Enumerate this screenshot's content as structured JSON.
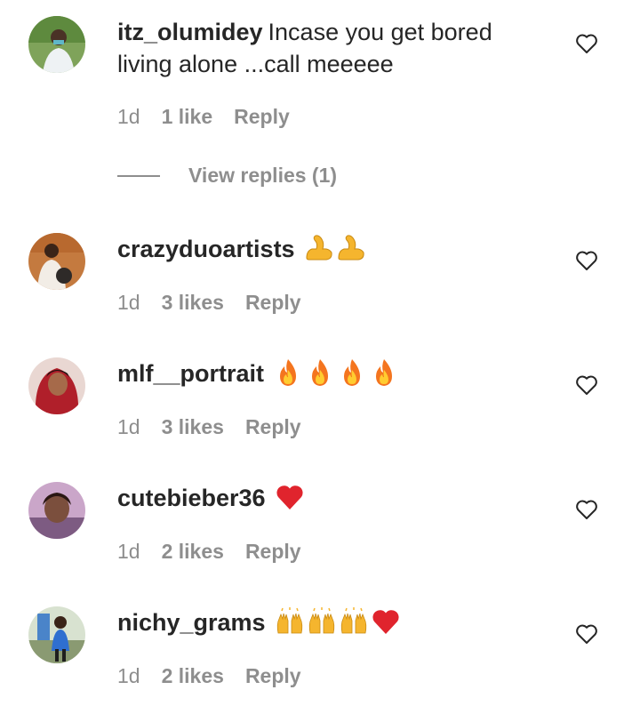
{
  "comments": [
    {
      "username": "itz_olumidey",
      "text_line1": "Incase you get bored",
      "text_line2": "living alone ...call meeeee",
      "time": "1d",
      "likes": "1 like",
      "reply": "Reply",
      "view_replies": "View replies (1)",
      "emojis": []
    },
    {
      "username": "crazyduoartists",
      "time": "1d",
      "likes": "3 likes",
      "reply": "Reply",
      "emojis": [
        "flexed-biceps",
        "flexed-biceps"
      ]
    },
    {
      "username": "mlf__portrait",
      "time": "1d",
      "likes": "3 likes",
      "reply": "Reply",
      "emojis": [
        "fire",
        "fire",
        "fire",
        "fire"
      ]
    },
    {
      "username": "cutebieber36",
      "time": "1d",
      "likes": "2 likes",
      "reply": "Reply",
      "emojis": [
        "red-heart"
      ]
    },
    {
      "username": "nichy_grams",
      "time": "1d",
      "likes": "2 likes",
      "reply": "Reply",
      "emojis": [
        "raising-hands",
        "raising-hands",
        "raising-hands",
        "red-heart"
      ]
    }
  ],
  "colors": {
    "text": "#262626",
    "secondary": "#8e8e8e",
    "heart_outline": "#262626"
  }
}
